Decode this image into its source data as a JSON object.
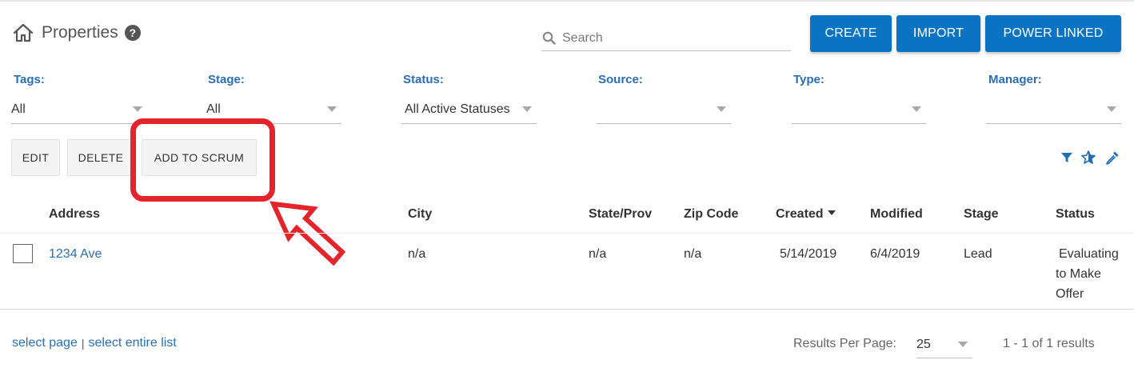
{
  "header": {
    "title": "Properties",
    "help_symbol": "?",
    "search_placeholder": "Search"
  },
  "buttons": {
    "create": "CREATE",
    "import": "IMPORT",
    "power_linked": "POWER LINKED"
  },
  "filters": {
    "tags": {
      "label": "Tags:",
      "value": "All"
    },
    "stage": {
      "label": "Stage:",
      "value": "All"
    },
    "status": {
      "label": "Status:",
      "value": "All Active Statuses"
    },
    "source": {
      "label": "Source:",
      "value": ""
    },
    "type": {
      "label": "Type:",
      "value": ""
    },
    "manager": {
      "label": "Manager:",
      "value": ""
    }
  },
  "actions": {
    "edit": "EDIT",
    "delete": "DELETE",
    "add_to_scrum": "ADD TO SCRUM"
  },
  "table": {
    "columns": {
      "address": "Address",
      "city": "City",
      "state": "State/Prov",
      "zip": "Zip Code",
      "created": "Created",
      "modified": "Modified",
      "stage": "Stage",
      "status": "Status"
    },
    "rows": [
      {
        "address": "1234 Ave",
        "city": "n/a",
        "state": "n/a",
        "zip": "n/a",
        "created": "5/14/2019",
        "modified": "6/4/2019",
        "stage": "Lead",
        "status_line1": "Evaluating",
        "status_line2": "to Make",
        "status_line3": "Offer"
      }
    ]
  },
  "footer": {
    "select_page": "select page",
    "separator": "|",
    "select_entire_list": "select entire list",
    "results_per_page_label": "Results Per Page:",
    "results_per_page_value": "25",
    "results_count": "1 - 1 of 1 results"
  },
  "colors": {
    "primary": "#0a73c2",
    "link": "#2a6eb3",
    "annotation": "#e3242b"
  },
  "icons": {
    "title": "home-icon",
    "help": "help-icon",
    "search": "search-icon",
    "filter": "filter-icon",
    "favorite": "star-icon",
    "color": "eyedropper-icon"
  }
}
